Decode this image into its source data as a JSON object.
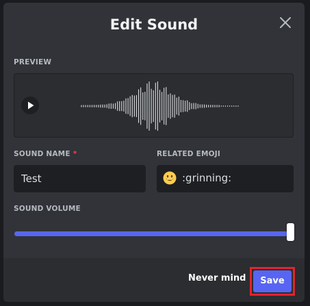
{
  "modal": {
    "title": "Edit Sound"
  },
  "preview": {
    "label": "PREVIEW"
  },
  "sound_name": {
    "label": "SOUND NAME",
    "required_mark": "*",
    "value": "Test"
  },
  "related_emoji": {
    "label": "RELATED EMOJI",
    "value": ":grinning:",
    "emoji_icon": "grinning-face-icon"
  },
  "volume": {
    "label": "SOUND VOLUME",
    "level_percent": 100
  },
  "footer": {
    "cancel_label": "Never mind",
    "save_label": "Save"
  },
  "colors": {
    "modal_bg": "#313338",
    "footer_bg": "#2b2d31",
    "accent": "#5865f2",
    "highlight": "#e3242b"
  }
}
